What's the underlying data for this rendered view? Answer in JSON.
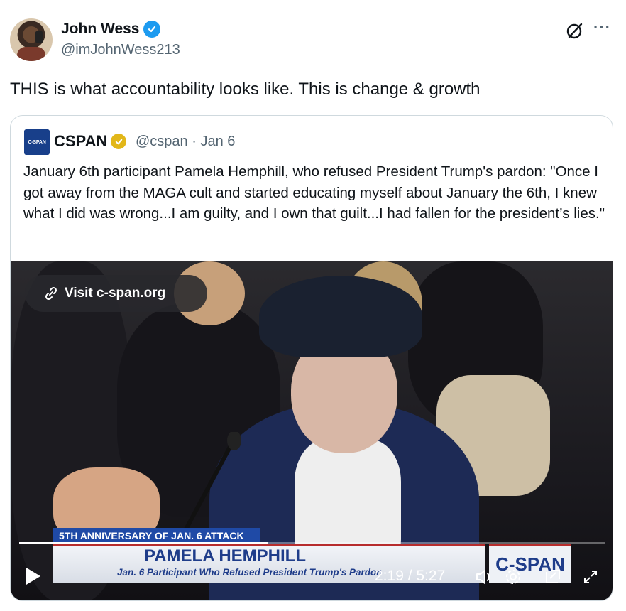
{
  "author": {
    "name": "John Wess",
    "handle": "@imJohnWess213",
    "verified": true,
    "icons": [
      "grok-icon",
      "more-icon"
    ]
  },
  "tweet": {
    "text": "THIS is what accountability looks like. This is change & growth"
  },
  "quote": {
    "logo_text": "C-SPAN",
    "name": "CSPAN",
    "meta": "@cspan · Jan 6",
    "text": "January 6th participant Pamela Hemphill, who refused President Trump's pardon: \"Once I got away from the MAGA cult and started educating myself about January the 6th, I knew what I did was wrong...I am guilty, and I own that guilt...I had fallen for the president’s lies.\"",
    "video": {
      "visit_label": "Visit c-span.org",
      "banner_top": "5TH ANNIVERSARY OF JAN. 6 ATTACK",
      "banner_name": "PAMELA HEMPHILL",
      "banner_sub": "Jan. 6 Participant Who Refused President Trump's Pardon",
      "channel_logo": "C-SPAN",
      "time": "2:19 / 5:27",
      "progress": 0.425
    }
  },
  "colors": {
    "verified_blue": "#1d9bf0",
    "gold_badge": "#e2b719",
    "cspan_blue": "#1f3d8a",
    "text_secondary": "#536471"
  }
}
